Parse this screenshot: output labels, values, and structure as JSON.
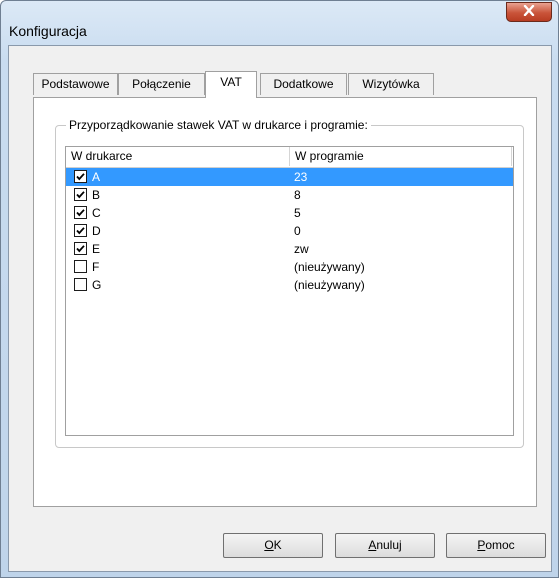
{
  "window": {
    "title": "Konfiguracja"
  },
  "tabs": [
    {
      "label": "Podstawowe"
    },
    {
      "label": "Połączenie"
    },
    {
      "label": "VAT",
      "active": true
    },
    {
      "label": "Dodatkowe"
    },
    {
      "label": "Wizytówka"
    }
  ],
  "vat": {
    "group_label": "Przyporządkowanie stawek VAT w drukarce i programie:",
    "columns": [
      "W drukarce",
      "W programie"
    ],
    "rows": [
      {
        "printer": "A",
        "program": "23",
        "checked": true,
        "selected": true
      },
      {
        "printer": "B",
        "program": "8",
        "checked": true
      },
      {
        "printer": "C",
        "program": "5",
        "checked": true
      },
      {
        "printer": "D",
        "program": "0",
        "checked": true
      },
      {
        "printer": "E",
        "program": "zw",
        "checked": true
      },
      {
        "printer": "F",
        "program": "(nieużywany)",
        "checked": false
      },
      {
        "printer": "G",
        "program": "(nieużywany)",
        "checked": false
      }
    ]
  },
  "buttons": {
    "ok": {
      "accel": "O",
      "rest": "K"
    },
    "cancel": {
      "accel": "A",
      "rest": "nuluj"
    },
    "help": {
      "accel": "P",
      "rest": "omoc"
    }
  },
  "colors": {
    "selection": "#3399ff",
    "close_button": "#c9543a"
  }
}
